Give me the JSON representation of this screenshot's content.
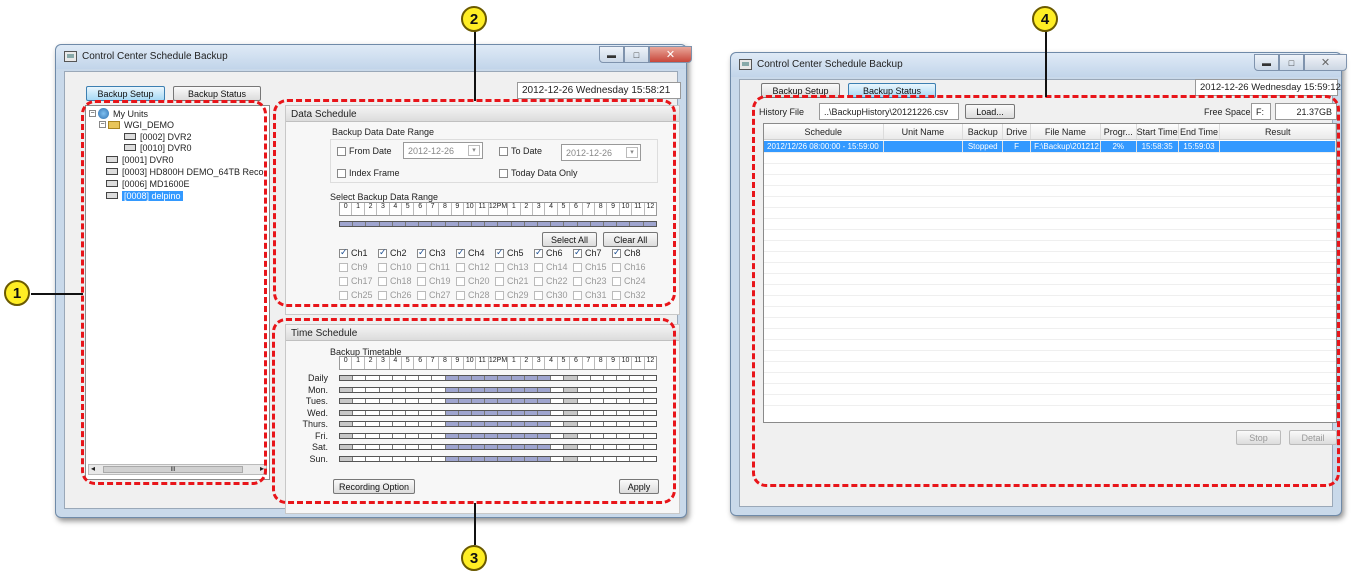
{
  "win1": {
    "title": "Control Center Schedule Backup",
    "tabs": [
      "Backup Setup",
      "Backup Status"
    ],
    "datetime": "2012-12-26  Wednesday  15:58:21",
    "tree": {
      "root": "My Units",
      "group": "WGI_DEMO",
      "items": [
        "[0002] DVR2",
        "[0010] DVR0",
        "[0001] DVR0",
        "[0003] HD800H DEMO_64TB Reco",
        "[0006] MD1600E",
        "[0008] delpino"
      ],
      "scroll_glyph": "III"
    },
    "data_schedule": {
      "title": "Data Schedule",
      "range_label": "Backup Data Date Range",
      "from_label": "From Date",
      "from_value": "2012-12-26",
      "to_label": "To Date",
      "to_value": "2012-12-26",
      "index_frame": "Index Frame",
      "today_only": "Today Data Only",
      "select_range_label": "Select Backup Data Range",
      "select_all": "Select All",
      "clear_all": "Clear All",
      "channels": [
        "Ch1",
        "Ch2",
        "Ch3",
        "Ch4",
        "Ch5",
        "Ch6",
        "Ch7",
        "Ch8",
        "Ch9",
        "Ch10",
        "Ch11",
        "Ch12",
        "Ch13",
        "Ch14",
        "Ch15",
        "Ch16",
        "Ch17",
        "Ch18",
        "Ch19",
        "Ch20",
        "Ch21",
        "Ch22",
        "Ch23",
        "Ch24",
        "Ch25",
        "Ch26",
        "Ch27",
        "Ch28",
        "Ch29",
        "Ch30",
        "Ch31",
        "Ch32"
      ],
      "checked_channels": 8
    },
    "ruler_labels": [
      "0",
      "1",
      "2",
      "3",
      "4",
      "5",
      "6",
      "7",
      "8",
      "9",
      "10",
      "11",
      "12PM",
      "1",
      "2",
      "3",
      "4",
      "5",
      "6",
      "7",
      "8",
      "9",
      "10",
      "11",
      "12"
    ],
    "time_schedule": {
      "title": "Time Schedule",
      "timetable_label": "Backup Timetable",
      "days": [
        "Daily",
        "Mon.",
        "Tues.",
        "Wed.",
        "Thurs.",
        "Fri.",
        "Sat.",
        "Sun."
      ],
      "recording_option": "Recording Option",
      "apply": "Apply"
    }
  },
  "win2": {
    "title": "Control Center Schedule Backup",
    "tabs": [
      "Backup Setup",
      "Backup Status"
    ],
    "datetime": "2012-12-26  Wednesday  15:59:12",
    "history_label": "History File",
    "history_value": "..\\BackupHistory\\20121226.csv",
    "load": "Load...",
    "free_space_label": "Free Space",
    "drive": "F:",
    "free_space_value": "21.37GB",
    "columns": [
      "Schedule",
      "Unit Name",
      "Backup",
      "Drive",
      "File Name",
      "Progr...",
      "Start Time",
      "End Time",
      "Result"
    ],
    "rows": [
      [
        "2012/12/26  08:00:00 - 15:59:00",
        "",
        "Stopped",
        "F",
        "F:\\Backup\\201212...",
        "2%",
        "15:58:35",
        "15:59:03",
        ""
      ]
    ],
    "stop": "Stop",
    "detail": "Detail"
  },
  "badges": [
    "1",
    "2",
    "3",
    "4"
  ],
  "colors": {
    "annotation": "#e8151a",
    "badge": "#ffee24",
    "selection": "#3399ff",
    "timetable_fill": "#9fa5cf"
  }
}
